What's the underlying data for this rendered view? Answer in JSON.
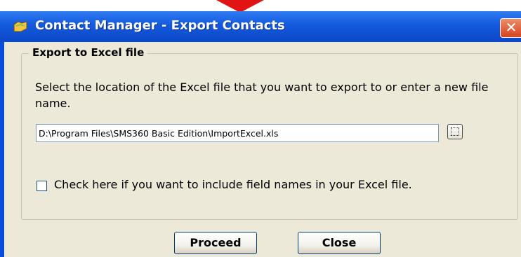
{
  "window": {
    "title": "Contact Manager - Export Contacts",
    "close_glyph": "✕"
  },
  "group": {
    "legend": "Export to Excel file",
    "instruction": "Select the location of the Excel file that you want to export to or enter a new file name.",
    "file_path": "D:\\Program Files\\SMS360 Basic Edition\\ImportExcel.xls",
    "include_field_names_label": "Check here if you want to include field names in your Excel file.",
    "include_field_names_checked": false
  },
  "buttons": {
    "proceed": "Proceed",
    "close": "Close"
  },
  "icons": [
    "app-icon",
    "close-icon",
    "browse-icon",
    "arrow-marker-icon"
  ],
  "colors": {
    "titlebar": "#0b48c8",
    "client_background": "#ece9d8",
    "close_button": "#d9411e",
    "marker": "#e01414"
  }
}
